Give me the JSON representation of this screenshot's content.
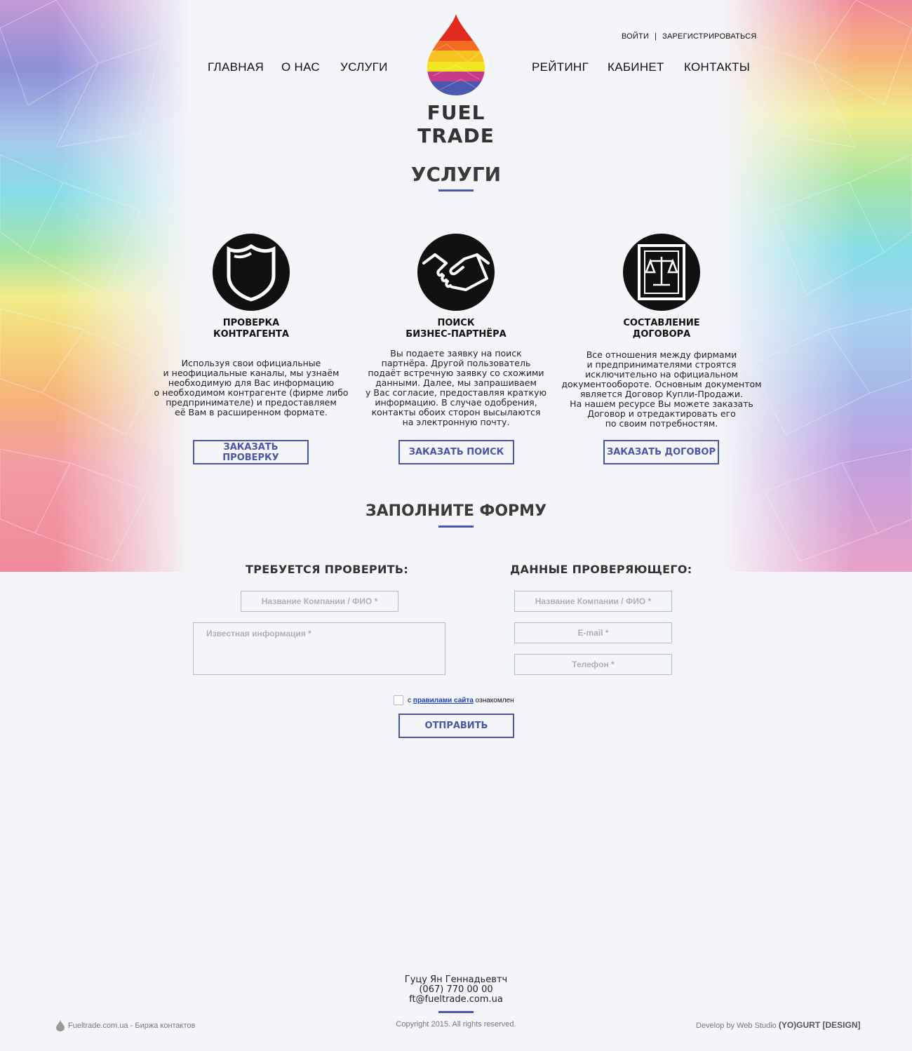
{
  "auth": {
    "login": "ВОЙТИ",
    "separator": "|",
    "register": "ЗАРЕГИСТРИРОВАТЬСЯ"
  },
  "nav": {
    "home": "ГЛАВНАЯ",
    "about": "О НАС",
    "services": "УСЛУГИ",
    "rating": "РЕЙТИНГ",
    "cabinet": "КАБИНЕТ",
    "contacts": "КОНТАКТЫ"
  },
  "brand": {
    "name": "FUEL TRADE"
  },
  "services": {
    "heading": "УСЛУГИ",
    "items": [
      {
        "icon": "shield-icon",
        "title1": "ПРОВЕРКА",
        "title2": "КОНТРАГЕНТА",
        "desc": "Используя свои официальные\nи неофициальные каналы, мы узнаём\nнеобходимую для Вас информацию\nо необходимом контрагенте (фирме либо\nпредпринимателе) и предоставляем\nеё Вам в расширенном формате.",
        "button": "ЗАКАЗАТЬ ПРОВЕРКУ"
      },
      {
        "icon": "handshake-icon",
        "title1": "ПОИСК",
        "title2": "БИЗНЕС-ПАРТНЁРА",
        "desc": "Вы подаете заявку на поиск\nпартнёра. Другой пользователь\nподаёт встречную заявку со схожими\nданными. Далее, мы запрашиваем\nу Вас согласие, предоставляя краткую\nинформацию. В случае одобрения,\nконтакты обоих сторон высылаются\nна электронную почту.",
        "button": "ЗАКАЗАТЬ ПОИСК"
      },
      {
        "icon": "contract-scales-icon",
        "title1": "СОСТАВЛЕНИЕ",
        "title2": "ДОГОВОРА",
        "desc": "Все отношения между фирмами\nи предпринимателями строятся\nисключительно на официальном\nдокументообороте. Основным документом\nявляется Договор Купли-Продажи.\nНа нашем ресурсе Вы можете заказать\nДоговор и отредактировать его\nпо своим потребностям.",
        "button": "ЗАКАЗАТЬ ДОГОВОР"
      }
    ]
  },
  "form": {
    "heading": "ЗАПОЛНИТЕ ФОРМУ",
    "left_heading": "ТРЕБУЕТСЯ ПРОВЕРИТЬ:",
    "right_heading": "ДАННЫЕ ПРОВЕРЯЮЩЕГО:",
    "target_name_placeholder": "Название Компании / ФИО *",
    "known_info_placeholder": "Известная информация *",
    "checker_name_placeholder": "Название Компании / ФИО *",
    "email_placeholder": "E-mail *",
    "phone_placeholder": "Телефон *",
    "agree_prefix": "с",
    "agree_link": "правилами сайта",
    "agree_suffix": "ознакомлен",
    "submit": "ОТПРАВИТЬ"
  },
  "contacts": {
    "name": "Гуцу Ян Геннадьевтч",
    "phone": "(067) 770 00 00",
    "email": "ft@fueltrade.com.ua"
  },
  "footer": {
    "site": "Fueltrade.com.ua - Биржа контактов",
    "copyright": "Copyright 2015. All rights reserved.",
    "developer_prefix": "Develop by Web Studio",
    "developer_brand": "(YO)GURT [DESIGN]"
  },
  "colors": {
    "accent": "#4a56a6",
    "background": "#f4f5f8",
    "text": "#222222"
  }
}
